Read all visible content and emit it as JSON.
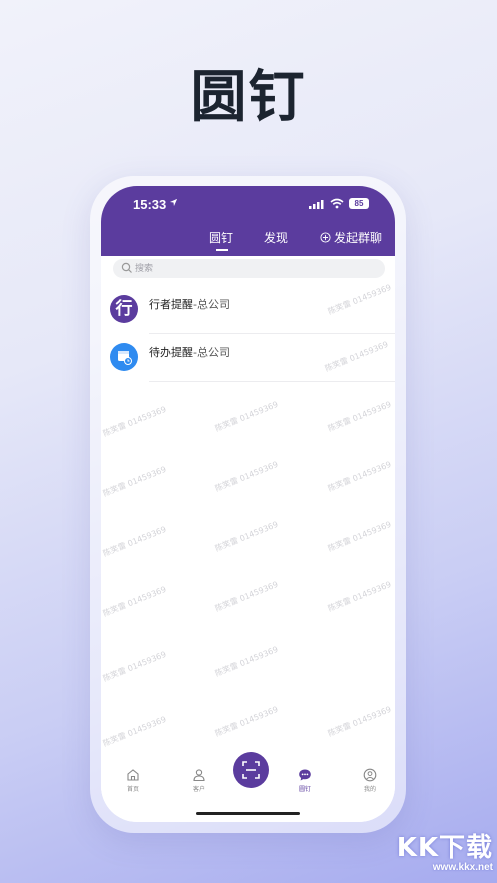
{
  "headline": "圆钉",
  "status_bar": {
    "time": "15:33",
    "battery": "85"
  },
  "top_tabs": [
    {
      "label": "圆钉",
      "active": true
    },
    {
      "label": "发现",
      "active": false
    }
  ],
  "new_group_label": "发起群聊",
  "search": {
    "placeholder": "搜索"
  },
  "conversations": [
    {
      "avatar_text": "行",
      "title": "行者提醒",
      "subtitle": "-总公司",
      "avatar_color": "#5b3c9e"
    },
    {
      "title": "待办提醒",
      "subtitle": "-总公司",
      "avatar_color": "#2f8bf0"
    }
  ],
  "watermark_text": "陈笑雷 01459369",
  "bottom_nav": [
    {
      "label": "首页",
      "icon": "home-icon",
      "active": false
    },
    {
      "label": "客户",
      "icon": "customer-icon",
      "active": false
    },
    {
      "label": "圆钉",
      "icon": "chat-icon",
      "active": true
    },
    {
      "label": "我的",
      "icon": "profile-icon",
      "active": false
    }
  ],
  "site_logo": {
    "text": "KK下载",
    "url": "www.kkx.net"
  },
  "colors": {
    "brand": "#5b3c9e",
    "accent_blue": "#2f8bf0"
  }
}
